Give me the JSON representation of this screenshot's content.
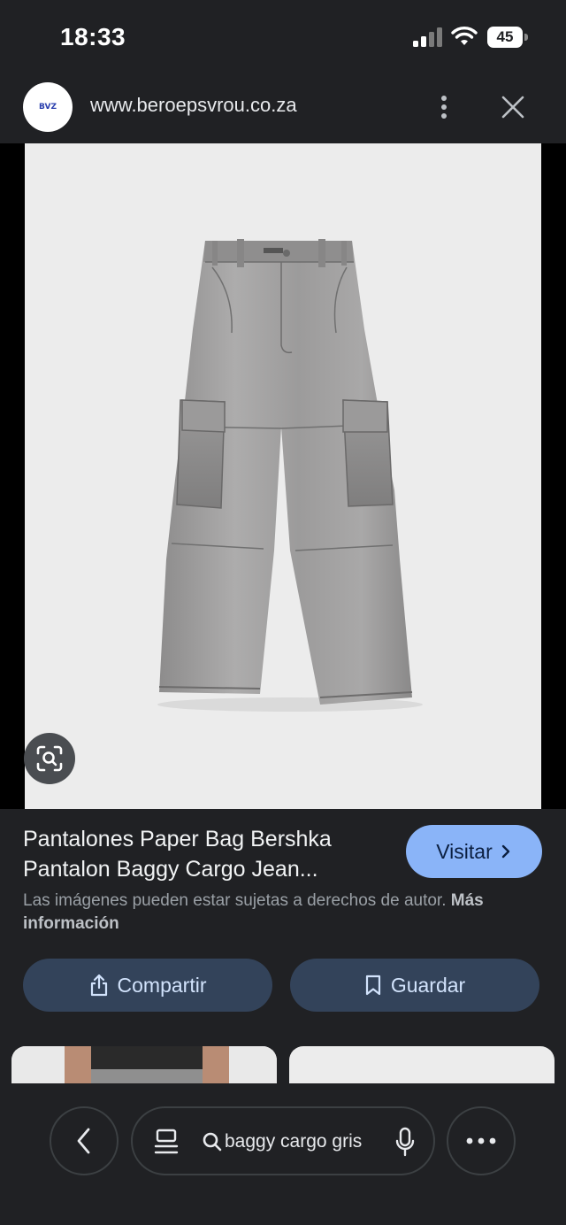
{
  "status_bar": {
    "time": "18:33",
    "battery": "45"
  },
  "browser": {
    "url": "www.beroepsvrou.co.za",
    "site_logo_text": "BVZ",
    "icons": {
      "menu": "more-vert-icon",
      "close": "close-icon"
    }
  },
  "result": {
    "title_line_1": "Pantalones Paper Bag Bershka",
    "title_line_2": "Pantalon Baggy Cargo Jean...",
    "visit_label": "Visitar",
    "copyright_text": "Las imágenes pueden estar sujetas a derechos de autor.",
    "more_info_label": "Más información",
    "share_label": "Compartir",
    "save_label": "Guardar"
  },
  "bottom_bar": {
    "search_query": "baggy cargo gris"
  },
  "colors": {
    "background": "#202124",
    "visit_button": "#8ab4f8",
    "action_button": "#33435a",
    "image_background": "#ececec"
  }
}
